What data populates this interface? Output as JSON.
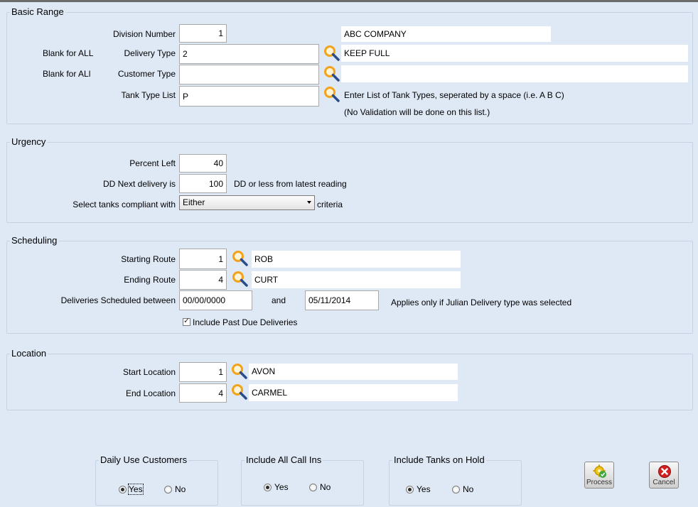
{
  "basic_range": {
    "title": "Basic Range",
    "division_label": "Division Number",
    "division_value": "1",
    "division_name": "ABC COMPANY",
    "blank_all_1": "Blank for ALL",
    "delivery_type_label": "Delivery Type",
    "delivery_type_value": "2",
    "delivery_type_desc": "KEEP FULL",
    "blank_all_2": "Blank for ALl",
    "customer_type_label": "Customer Type",
    "customer_type_value": "",
    "customer_type_desc": "",
    "tank_type_label": "Tank Type List",
    "tank_type_value": "P",
    "tank_hint_1": "Enter List of Tank Types, seperated by a space (i.e. A B C)",
    "tank_hint_2": "(No Validation will be done on this list.)"
  },
  "urgency": {
    "title": "Urgency",
    "percent_left_label": "Percent Left",
    "percent_left_value": "40",
    "dd_next_label": "DD Next delivery is",
    "dd_next_value": "100",
    "dd_next_suffix": "DD or less from latest reading",
    "compliant_label": "Select tanks compliant with",
    "compliant_value": "Either",
    "compliant_suffix": "criteria"
  },
  "scheduling": {
    "title": "Scheduling",
    "start_route_label": "Starting Route",
    "start_route_value": "1",
    "start_route_name": "ROB",
    "end_route_label": "Ending Route",
    "end_route_value": "4",
    "end_route_name": "CURT",
    "deliveries_label": "Deliveries Scheduled between",
    "date_from": "00/00/0000",
    "and_label": "and",
    "date_to": "05/11/2014",
    "julian_note": "Applies only if Julian Delivery type was selected",
    "past_due_label": "Include Past Due Deliveries",
    "past_due_checked": true
  },
  "location": {
    "title": "Location",
    "start_label": "Start Location",
    "start_value": "1",
    "start_name": "AVON",
    "end_label": "End Location",
    "end_value": "4",
    "end_name": "CARMEL"
  },
  "options": {
    "daily_use": {
      "title": "Daily Use Customers",
      "yes": "Yes",
      "no": "No",
      "selected": "Yes"
    },
    "call_ins": {
      "title": "Include All Call Ins",
      "yes": "Yes",
      "no": "No",
      "selected": "Yes"
    },
    "on_hold": {
      "title": "Include Tanks on Hold",
      "yes": "Yes",
      "no": "No",
      "selected": "Yes"
    }
  },
  "actions": {
    "process_label": "Process",
    "cancel_label": "Cancel"
  },
  "icons": {
    "lookup": "magnifier-icon",
    "process": "gear-check-icon",
    "cancel": "red-x-icon"
  },
  "colors": {
    "background": "#dfe9f6",
    "group_border": "#c4d2e4",
    "magnifier_lens": "#f2a31b",
    "magnifier_handle": "#2a4d8a",
    "cancel_red": "#d42020"
  }
}
